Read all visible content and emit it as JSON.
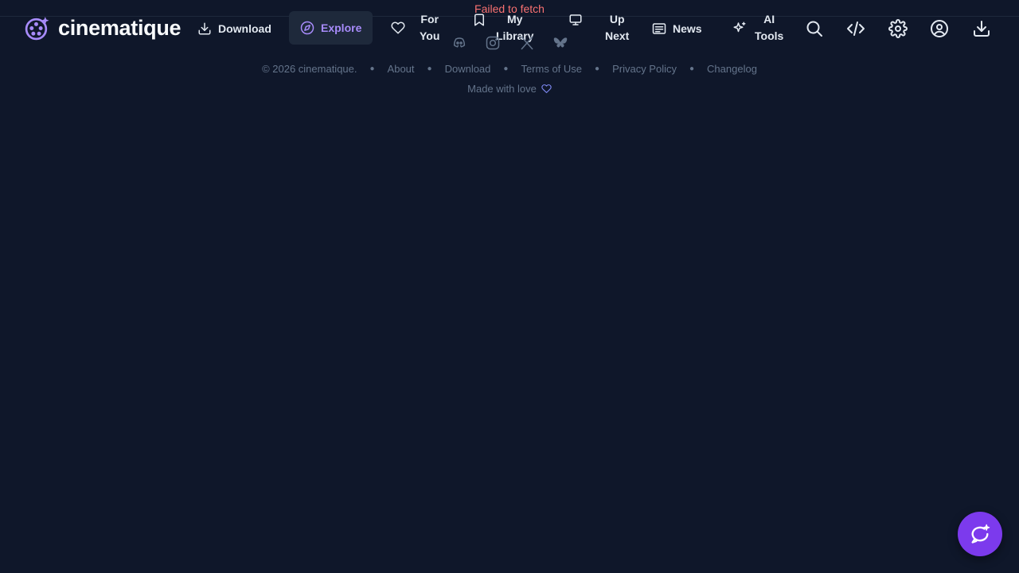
{
  "app": {
    "name": "cinematique"
  },
  "error": "Failed to fetch",
  "nav": {
    "download": "Download",
    "explore": "Explore",
    "for_you_1": "For",
    "for_you_2": "You",
    "library_1": "My",
    "library_2": "Library",
    "up_next_1": "Up",
    "up_next_2": "Next",
    "news": "News",
    "ai_tools_1": "AI",
    "ai_tools_2": "Tools"
  },
  "footer": {
    "copyright": "© 2026 cinematique.",
    "links": [
      "About",
      "Download",
      "Terms of Use",
      "Privacy Policy",
      "Changelog"
    ],
    "made_with": "Made with love"
  },
  "colors": {
    "background": "#0f172a",
    "accent": "#a78bfa",
    "fab": "#7c3aed",
    "error": "#f87171"
  }
}
